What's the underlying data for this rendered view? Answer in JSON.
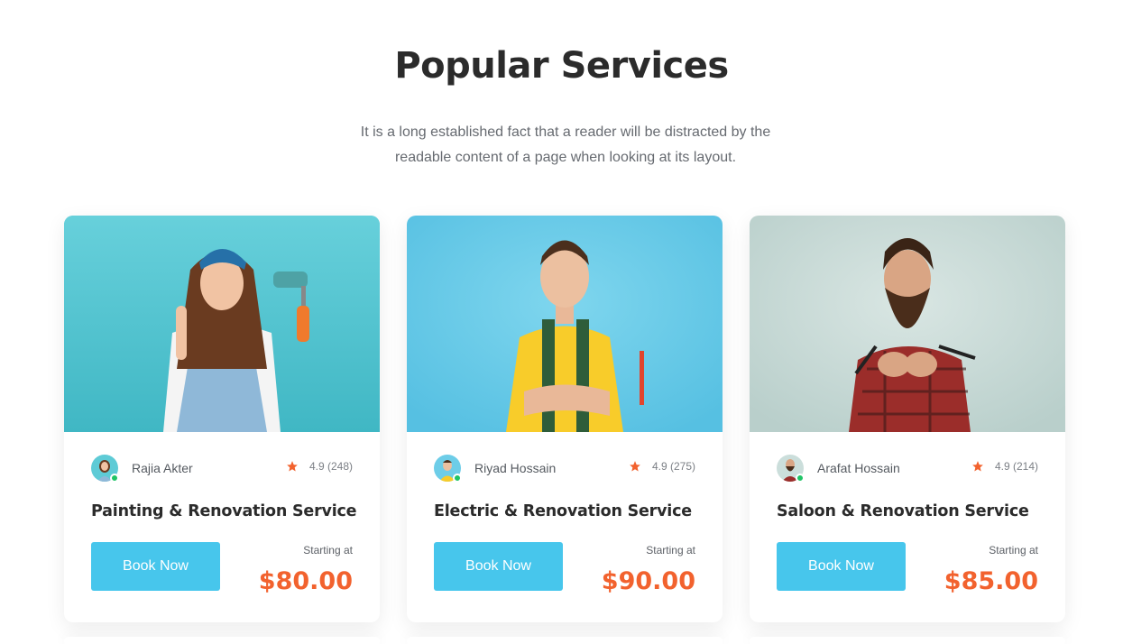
{
  "section": {
    "title": "Popular Services",
    "subtitle": "It is a long established fact that a reader will be distracted by the readable content of a page when looking at its layout."
  },
  "colors": {
    "accent": "#47c6ec",
    "price": "#f2622e",
    "star": "#f2622e",
    "online": "#1fc466"
  },
  "services": [
    {
      "provider": "Rajia Akter",
      "rating": "4.9 (248)",
      "title": "Painting & Renovation Service",
      "button": "Book Now",
      "starting_label": "Starting at",
      "price": "$80.00",
      "photo_bg": "#5ecbd6"
    },
    {
      "provider": "Riyad Hossain",
      "rating": "4.9 (275)",
      "title": "Electric & Renovation Service",
      "button": "Book Now",
      "starting_label": "Starting at",
      "price": "$90.00",
      "photo_bg": "#6dcde8"
    },
    {
      "provider": "Arafat Hossain",
      "rating": "4.9 (214)",
      "title": "Saloon & Renovation Service",
      "button": "Book Now",
      "starting_label": "Starting at",
      "price": "$85.00",
      "photo_bg": "#cbdedb"
    }
  ]
}
